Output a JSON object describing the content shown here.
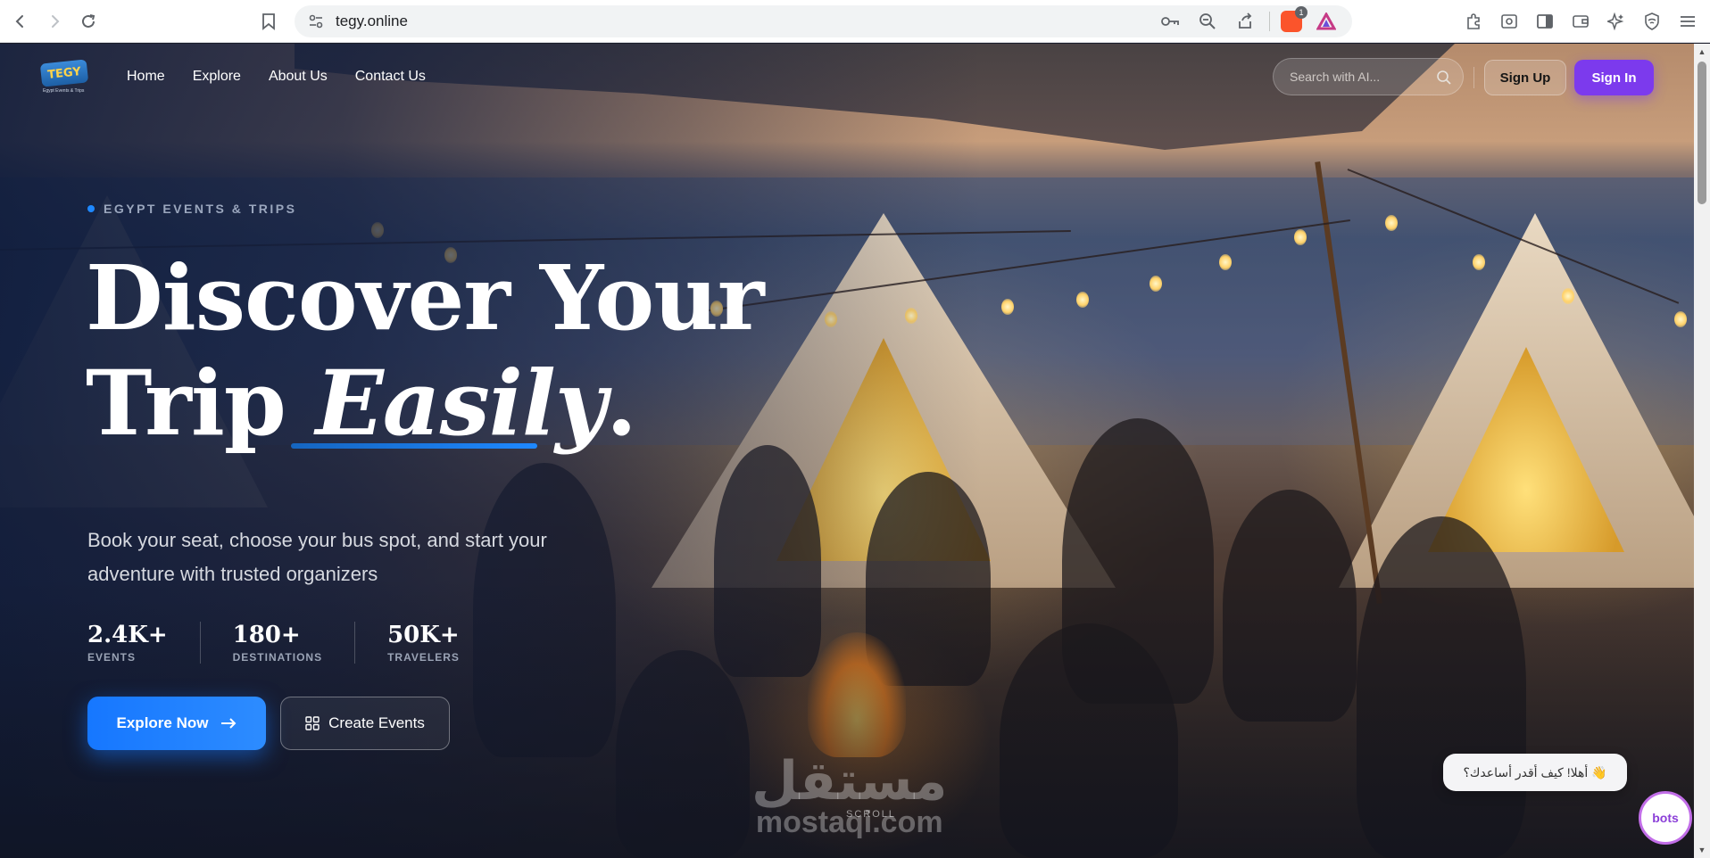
{
  "browser": {
    "url": "tegy.online",
    "extension_badge": "1",
    "icons": [
      "back-icon",
      "forward-icon",
      "reload-icon",
      "bookmark-icon",
      "site-settings-icon",
      "password-key-icon",
      "zoom-out-icon",
      "share-icon",
      "brave-shields-icon",
      "brave-rewards-icon",
      "extensions-icon",
      "tab-search-icon",
      "sidebar-icon",
      "wallet-icon",
      "leo-ai-icon",
      "vpn-icon",
      "menu-icon"
    ]
  },
  "header": {
    "logo_text": "TEGY",
    "logo_tagline": "Egypt Events & Trips",
    "nav": [
      "Home",
      "Explore",
      "About Us",
      "Contact Us"
    ],
    "search_placeholder": "Search with AI...",
    "signup_label": "Sign Up",
    "signin_label": "Sign In",
    "signin_color": "#7c3aed"
  },
  "hero": {
    "eyebrow": "EGYPT EVENTS & TRIPS",
    "title_line1": "Discover Your",
    "title_line2_prefix": "Trip ",
    "title_line2_emph": "Easily",
    "title_line2_suffix": ".",
    "subtitle": "Book your seat, choose your bus spot, and start your adventure with trusted organizers",
    "stats": [
      {
        "value": "2.4K+",
        "label": "EVENTS"
      },
      {
        "value": "180+",
        "label": "DESTINATIONS"
      },
      {
        "value": "50K+",
        "label": "TRAVELERS"
      }
    ],
    "primary_cta": "Explore Now",
    "secondary_cta": "Create Events",
    "accent_color": "#1677ff",
    "scroll_label": "SCROLL"
  },
  "watermark": {
    "arabic": "مستقل",
    "latin": "mostaqi.com"
  },
  "chat": {
    "greeting": "👋 أهلا! كيف أقدر أساعدك؟",
    "launcher_label": "bots"
  }
}
